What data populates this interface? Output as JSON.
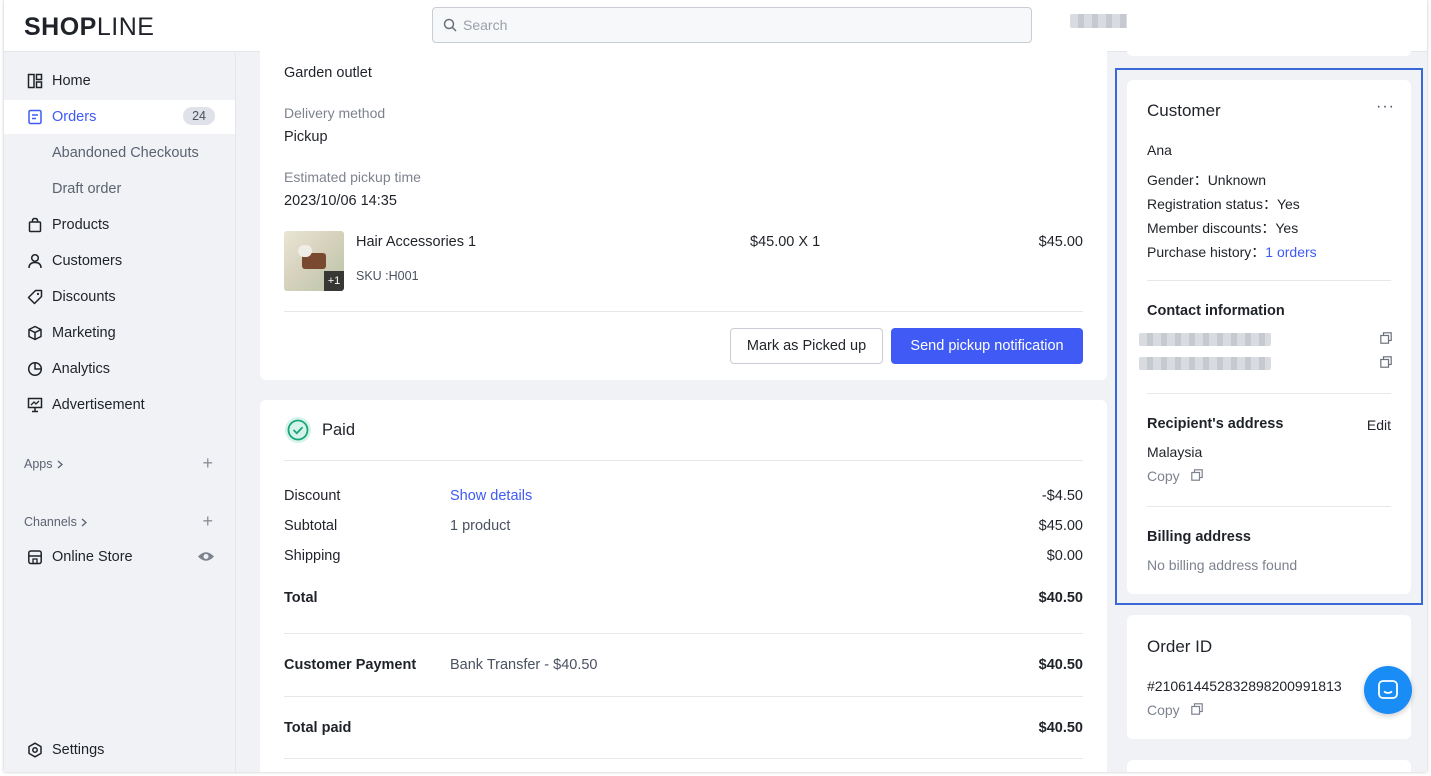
{
  "header": {
    "logo_bold": "SHOP",
    "logo_light": "LINE",
    "search_placeholder": "Search"
  },
  "sidebar": {
    "home": "Home",
    "orders": "Orders",
    "orders_count": "24",
    "abandoned": "Abandoned Checkouts",
    "draft": "Draft order",
    "products": "Products",
    "customers": "Customers",
    "discounts": "Discounts",
    "marketing": "Marketing",
    "analytics": "Analytics",
    "advertisement": "Advertisement",
    "apps": "Apps",
    "channels": "Channels",
    "online_store": "Online Store",
    "settings": "Settings"
  },
  "pickup": {
    "location": "Garden outlet",
    "delivery_label": "Delivery method",
    "delivery_value": "Pickup",
    "time_label": "Estimated pickup time",
    "time_value": "2023/10/06 14:35",
    "item_name": "Hair Accessories 1",
    "item_sku": "SKU :H001",
    "item_more": "+1",
    "item_qty": "$45.00 X 1",
    "item_total": "$45.00",
    "btn_picked": "Mark as Picked up",
    "btn_notify": "Send pickup notification"
  },
  "payment": {
    "status": "Paid",
    "discount_label": "Discount",
    "discount_link": "Show details",
    "discount_value": "-$4.50",
    "subtotal_label": "Subtotal",
    "subtotal_desc": "1 product",
    "subtotal_value": "$45.00",
    "shipping_label": "Shipping",
    "shipping_value": "$0.00",
    "total_label": "Total",
    "total_value": "$40.50",
    "cust_pay_label": "Customer Payment",
    "cust_pay_desc": "Bank Transfer - $40.50",
    "cust_pay_value": "$40.50",
    "total_paid_label": "Total paid",
    "total_paid_value": "$40.50"
  },
  "customer": {
    "title": "Customer",
    "name": "Ana",
    "gender": "Gender：Unknown",
    "registration": "Registration status：Yes",
    "member": "Member discounts：Yes",
    "history_label": "Purchase history：",
    "history_link": "1 orders",
    "contact_title": "Contact information",
    "recipient_title": "Recipient's address",
    "edit": "Edit",
    "country": "Malaysia",
    "copy": "Copy",
    "billing_title": "Billing address",
    "billing_empty": "No billing address found"
  },
  "order": {
    "title": "Order ID",
    "id": "#210614452832898200991813",
    "copy": "Copy"
  },
  "colors": {
    "accent": "#3f5af5",
    "paid": "#1aa57a",
    "highlight": "#3a68d8"
  }
}
